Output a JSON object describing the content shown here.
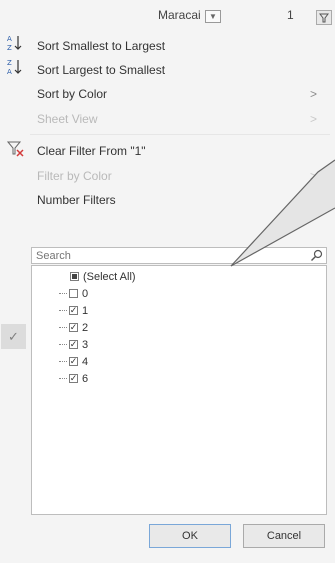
{
  "header": {
    "column_name": "Maracai",
    "column_value": "1",
    "dropdown_glyph": "▼"
  },
  "menu": {
    "sort_smallest": "Sort Smallest to Largest",
    "sort_largest": "Sort Largest to Smallest",
    "sort_by_color": "Sort by Color",
    "sheet_view": "Sheet View",
    "clear_filter": "Clear Filter From \"1\"",
    "filter_by_color": "Filter by Color",
    "number_filters": "Number Filters",
    "chevron": ">"
  },
  "search": {
    "placeholder": "Search",
    "value": ""
  },
  "values_list": [
    {
      "label": "(Select All)",
      "state": "indeterminate"
    },
    {
      "label": "0",
      "state": "unchecked"
    },
    {
      "label": "1",
      "state": "checked"
    },
    {
      "label": "2",
      "state": "checked"
    },
    {
      "label": "3",
      "state": "checked"
    },
    {
      "label": "4",
      "state": "checked"
    },
    {
      "label": "6",
      "state": "checked"
    }
  ],
  "buttons": {
    "ok": "OK",
    "cancel": "Cancel"
  },
  "side_check": "✓",
  "colors": {
    "background": "#f4f4f4",
    "disabled_text": "#b9b9b9",
    "ok_border": "#7aa7d8",
    "filter_icon": "#d23a3a"
  }
}
